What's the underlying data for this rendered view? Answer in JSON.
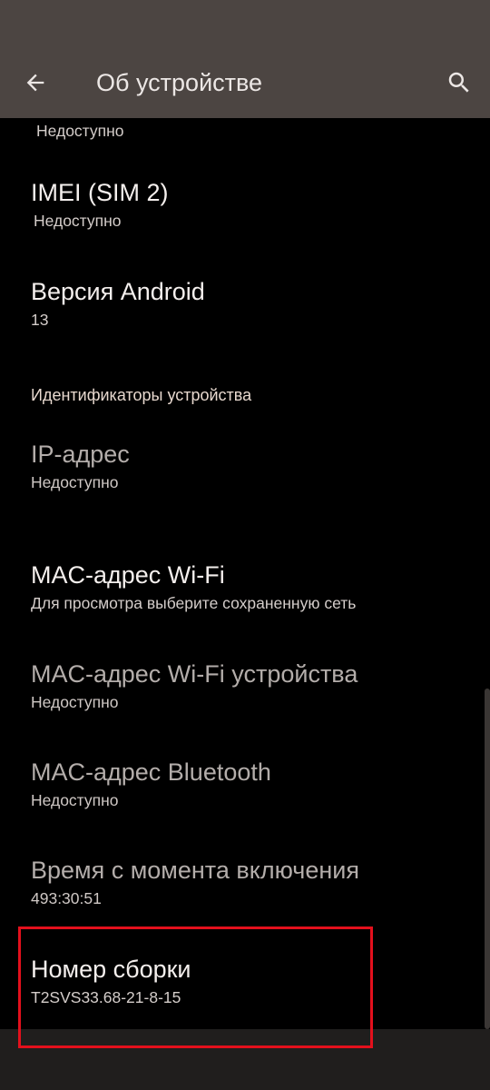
{
  "header": {
    "title": "Об устройстве",
    "back_icon": "arrow-left-icon",
    "search_icon": "search-icon"
  },
  "items": [
    {
      "subtitle": "Недоступно"
    },
    {
      "title": "IMEI (SIM 2)",
      "subtitle": "Недоступно"
    },
    {
      "title": "Версия Android",
      "subtitle": "13"
    },
    {
      "section": "Идентификаторы устройства"
    },
    {
      "title": "IP-адрес",
      "subtitle": "Недоступно"
    },
    {
      "title": "MAC-адрес Wi-Fi",
      "subtitle": "Для просмотра выберите сохраненную сеть"
    },
    {
      "title": "MAC-адрес Wi-Fi устройства",
      "subtitle": "Недоступно"
    },
    {
      "title": "MAC-адрес Bluetooth",
      "subtitle": "Недоступно"
    },
    {
      "title": "Время с момента включения",
      "subtitle": "493:30:51"
    },
    {
      "title": "Номер сборки",
      "subtitle": "T2SVS33.68-21-8-15"
    }
  ],
  "colors": {
    "app_bar": "#4c4542",
    "background": "#000000",
    "highlight": "#e3101c"
  }
}
